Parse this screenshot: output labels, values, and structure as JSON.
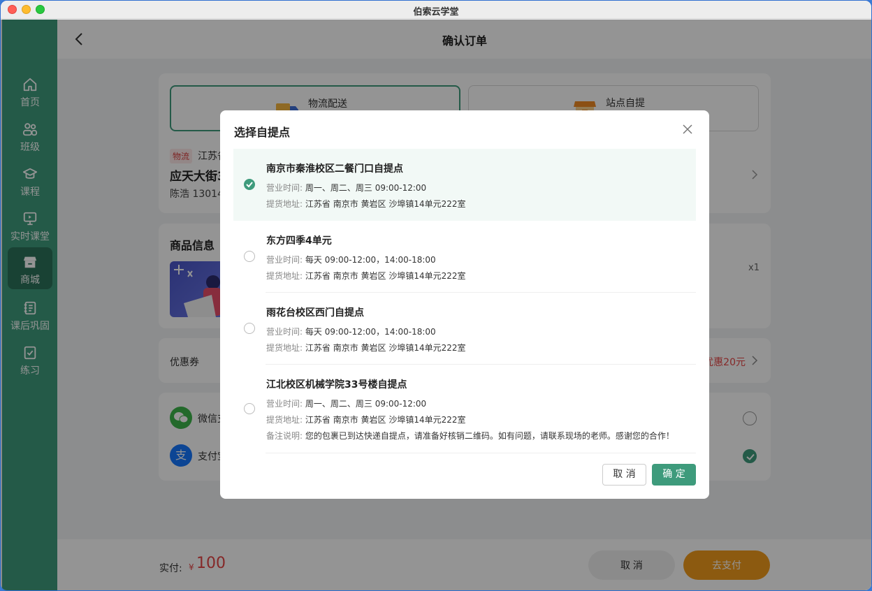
{
  "window": {
    "title": "伯索云学堂"
  },
  "sidebar": {
    "items": [
      {
        "label": "首页",
        "icon": "home-icon"
      },
      {
        "label": "班级",
        "icon": "people-icon"
      },
      {
        "label": "课程",
        "icon": "graduation-cap-icon"
      },
      {
        "label": "实时课堂",
        "icon": "live-class-icon"
      },
      {
        "label": "商城",
        "icon": "store-icon",
        "active": true
      },
      {
        "label": "课后巩固",
        "icon": "notebook-icon"
      },
      {
        "label": "练习",
        "icon": "checklist-icon"
      }
    ]
  },
  "header": {
    "title": "确认订单"
  },
  "delivery": {
    "options": [
      {
        "label": "物流配送",
        "selected": true
      },
      {
        "label": "站点自提",
        "selected": false
      }
    ],
    "tag": "物流",
    "address_line1": "江苏省",
    "address_line2": "应天大街3",
    "contact": "陈浩   13014"
  },
  "goods": {
    "title": "商品信息",
    "qty": "x1"
  },
  "coupon": {
    "label": "优惠券",
    "value": "优惠20元"
  },
  "payment": {
    "methods": [
      {
        "label": "微信支",
        "selected": false
      },
      {
        "label": "支付宝",
        "selected": true
      }
    ]
  },
  "footer": {
    "total_label": "实付:",
    "currency": "¥",
    "total": "100",
    "cancel_label": "取 消",
    "pay_label": "去支付"
  },
  "modal": {
    "title": "选择自提点",
    "hours_key": "营业时间:",
    "addr_key": "提货地址:",
    "note_key": "备注说明:",
    "points": [
      {
        "name": "南京市秦淮校区二餐门口自提点",
        "hours": "周一、周二、周三 09:00-12:00",
        "address": "江苏省 南京市 黄岩区 沙埠镇14单元222室",
        "selected": true
      },
      {
        "name": "东方四季4单元",
        "hours": "每天 09:00-12:00，14:00-18:00",
        "address": "江苏省 南京市 黄岩区 沙埠镇14单元222室",
        "selected": false
      },
      {
        "name": "雨花台校区西门自提点",
        "hours": "每天 09:00-12:00，14:00-18:00",
        "address": "江苏省 南京市 黄岩区 沙埠镇14单元222室",
        "selected": false
      },
      {
        "name": "江北校区机械学院33号楼自提点",
        "hours": "周一、周二、周三 09:00-12:00",
        "address": "江苏省 南京市 黄岩区 沙埠镇14单元222室",
        "note": "您的包裹已到达快递自提点，请准备好核销二维码。如有问题，请联系现场的老师。感谢您的合作！",
        "selected": false
      }
    ],
    "cancel_label": "取 消",
    "ok_label": "确 定"
  },
  "colors": {
    "accent": "#3e9b7c",
    "price": "#e64545",
    "pay_button": "#f29b1c"
  }
}
